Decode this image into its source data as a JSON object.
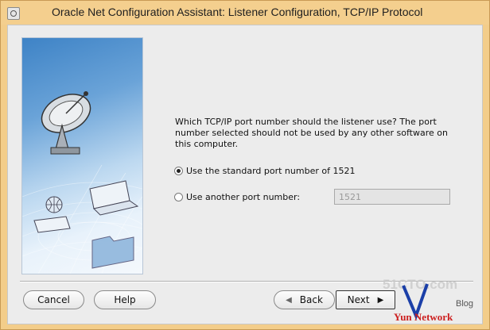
{
  "window": {
    "title": "Oracle Net Configuration Assistant: Listener Configuration, TCP/IP Protocol"
  },
  "main": {
    "description": "Which TCP/IP port number should the listener use? The port number selected should not be used by any other software on this computer.",
    "option_standard_label": "Use the standard port number of 1521",
    "option_another_label": "Use another port number:",
    "selected_option": "standard",
    "port_value": "1521"
  },
  "buttons": {
    "cancel": "Cancel",
    "help": "Help",
    "back": "Back",
    "next": "Next"
  },
  "watermark": {
    "site": "51CTO.com",
    "blog": "Blog",
    "brand": "Yun Network"
  },
  "colors": {
    "title_bar": "#f4cf8e",
    "client_bg": "#ececec",
    "image_top": "#3e83c6"
  },
  "icons": [
    "app-icon",
    "satellite-dish-icon",
    "network-globe-icon",
    "laptop-icon",
    "folder-icon",
    "back-arrow-icon",
    "next-arrow-icon"
  ]
}
